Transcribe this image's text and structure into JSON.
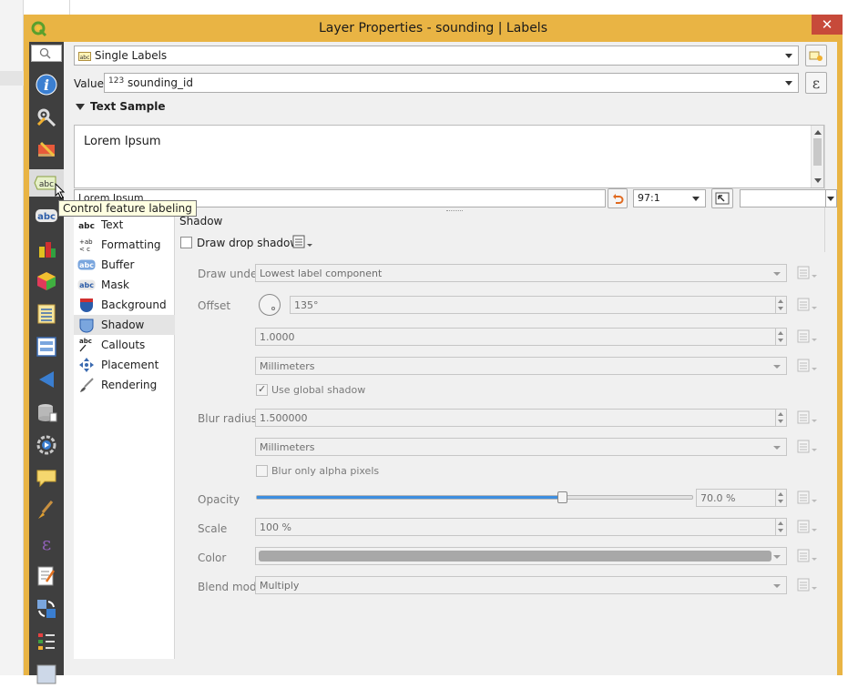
{
  "window": {
    "title": "Layer Properties - sounding | Labels",
    "close_label": "✕"
  },
  "sidebar": {
    "search_icon": "search-icon",
    "items": [
      {
        "name": "information-icon"
      },
      {
        "name": "source-icon"
      },
      {
        "name": "symbology-icon"
      },
      {
        "name": "labels-icon",
        "selected": true
      },
      {
        "name": "masks-icon"
      },
      {
        "name": "3d-view-icon"
      },
      {
        "name": "diagrams-icon"
      },
      {
        "name": "fields-icon"
      },
      {
        "name": "attributes-form-icon"
      },
      {
        "name": "joins-icon"
      },
      {
        "name": "auxiliary-storage-icon"
      },
      {
        "name": "actions-icon"
      },
      {
        "name": "display-icon"
      },
      {
        "name": "rendering-icon"
      },
      {
        "name": "variables-icon"
      },
      {
        "name": "metadata-icon"
      },
      {
        "name": "dependencies-icon"
      },
      {
        "name": "legend-icon"
      },
      {
        "name": "qgis-server-icon"
      }
    ]
  },
  "tooltip": {
    "text": "Control feature labeling"
  },
  "labels": {
    "mode": "Single Labels",
    "mode_badge": "abc",
    "value_label": "Value",
    "value_type_badge": "123",
    "value_field": "sounding_id",
    "expression_glyph": "ε"
  },
  "text_sample": {
    "heading": "Text Sample",
    "preview_text": "Lorem Ipsum",
    "sample_input": "Lorem Ipsum",
    "scale": "97:1"
  },
  "tabs": [
    {
      "label": "Text",
      "icon": "text-abc-icon"
    },
    {
      "label": "Formatting",
      "icon": "formatting-icon"
    },
    {
      "label": "Buffer",
      "icon": "buffer-icon"
    },
    {
      "label": "Mask",
      "icon": "mask-icon"
    },
    {
      "label": "Background",
      "icon": "background-icon"
    },
    {
      "label": "Shadow",
      "icon": "shadow-icon",
      "selected": true
    },
    {
      "label": "Callouts",
      "icon": "callouts-icon"
    },
    {
      "label": "Placement",
      "icon": "placement-icon"
    },
    {
      "label": "Rendering",
      "icon": "rendering-brush-icon"
    }
  ],
  "shadow": {
    "section_title": "Shadow",
    "draw_drop_shadow_label": "Draw drop shadow",
    "draw_drop_shadow_checked": false,
    "draw_under_label": "Draw under",
    "draw_under_value": "Lowest label component",
    "offset_label": "Offset",
    "offset_angle": "135°",
    "offset_distance": "1.0000",
    "offset_unit": "Millimeters",
    "use_global_shadow_label": "Use global shadow",
    "use_global_shadow_checked": true,
    "blur_radius_label": "Blur radius",
    "blur_radius_value": "1.500000",
    "blur_unit": "Millimeters",
    "blur_alpha_label": "Blur only alpha pixels",
    "blur_alpha_checked": false,
    "opacity_label": "Opacity",
    "opacity_value": "70.0 %",
    "opacity_fraction": 0.7,
    "scale_label": "Scale",
    "scale_value": "100 %",
    "color_label": "Color",
    "color_value": "#a8a8a8",
    "blend_mode_label": "Blend mode",
    "blend_mode_value": "Multiply"
  },
  "colors": {
    "title_bar": "#e9b444",
    "close_button": "#c74a3a",
    "sidebar_bg": "#3f3f3f",
    "slider_fill": "#3d8ee0"
  }
}
